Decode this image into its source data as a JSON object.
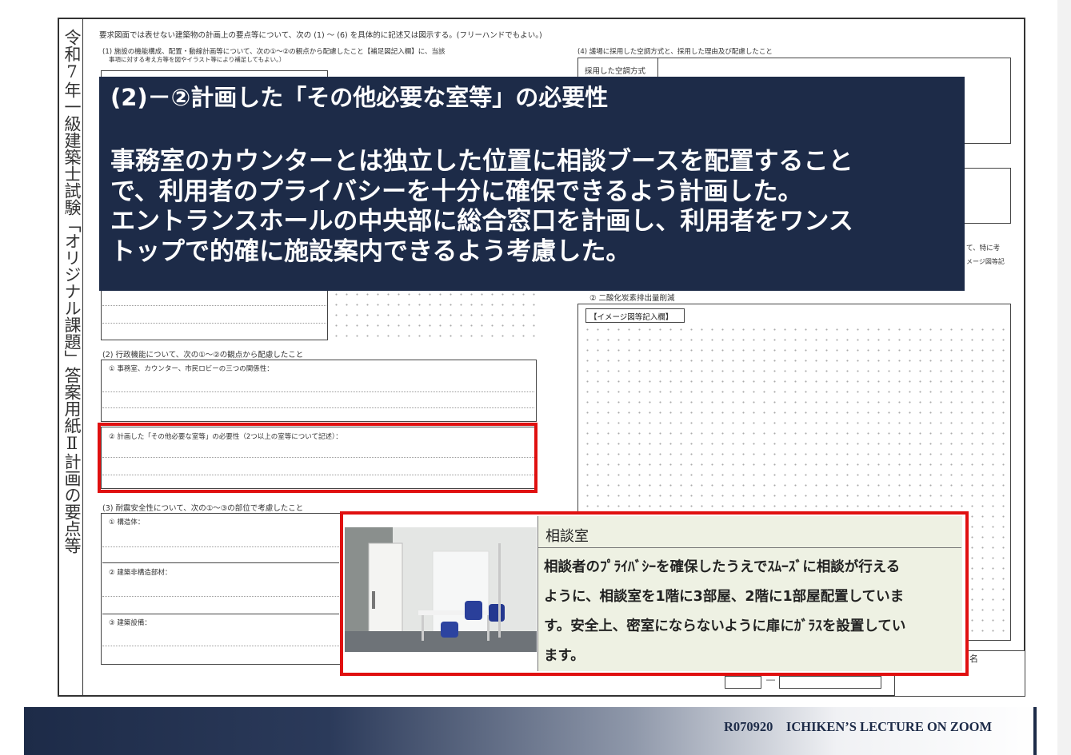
{
  "sheet": {
    "vertical_title": "令和7年一級建築士試験「オリジナル課題」答案用紙Ⅱ計画の要点等",
    "header": "要求図面では表せない建築物の計画上の要点等について、次の (1) ～ (6) を具体的に記述又は図示する。(フリーハンドでもよい。)",
    "q1": "(1) 施設の機能構成、配置・動線計画等について、次の①～②の観点から配慮したこと【補足図記入欄】に、当該",
    "q1b": "事項に対する考え方等を図やイラスト等により補足してもよい。）",
    "q4": "(4) 議場に採用した空調方式と、採用した理由及び配慮したこと",
    "q4_label": "採用した空調方式",
    "q2": "(2) 行政機能について、次の①～②の観点から配慮したこと",
    "q2_1": "① 事務室、カウンター、市民ロビーの三つの関係性：",
    "q2_2": "② 計画した「その他必要な室等」の必要性（2つ以上の室等について記述）：",
    "q3": "(3) 耐震安全性について、次の①～③の部位で考慮したこと",
    "q3_1": "① 構造体：",
    "q3_2": "② 建築非構造部材：",
    "q3_3": "③ 建築設備：",
    "q5_co2": "② 二酸化炭素排出量削減",
    "q5_image_label": "【イメージ図等記入欄】",
    "q5_cut1": "て、特に考",
    "q5_cut2": "メージ図等記",
    "name_cut": "名",
    "number_dash": "―"
  },
  "overlay": {
    "title": "(2)－②計画した「その他必要な室等」の必要性",
    "lines": [
      "事務室のカウンターとは独立した位置に相談ブースを配置すること",
      "で、利用者のプライバシーを十分に確保できるよう計画した。",
      "エントランスホールの中央部に総合窓口を計画し、利用者をワンス",
      "トップで的確に施設案内できるよう考慮した。"
    ]
  },
  "card": {
    "heading": "相談室",
    "lines": [
      "相談者のﾌﾟﾗｲﾊﾞｼｰを確保したうえでｽﾑｰｽﾞに相談が行える",
      "ように、相談室を1階に3部屋、2階に1部屋配置していま",
      "す。安全上、密室にならないように扉にｶﾞﾗｽを設置してい",
      "ます。"
    ]
  },
  "footer": {
    "text": "R070920　ICHIKEN’S LECTURE ON ZOOM"
  },
  "colors": {
    "overlay_bg": "#1d2b48",
    "highlight_red": "#e01010",
    "card_bg": "#eef1e3"
  }
}
